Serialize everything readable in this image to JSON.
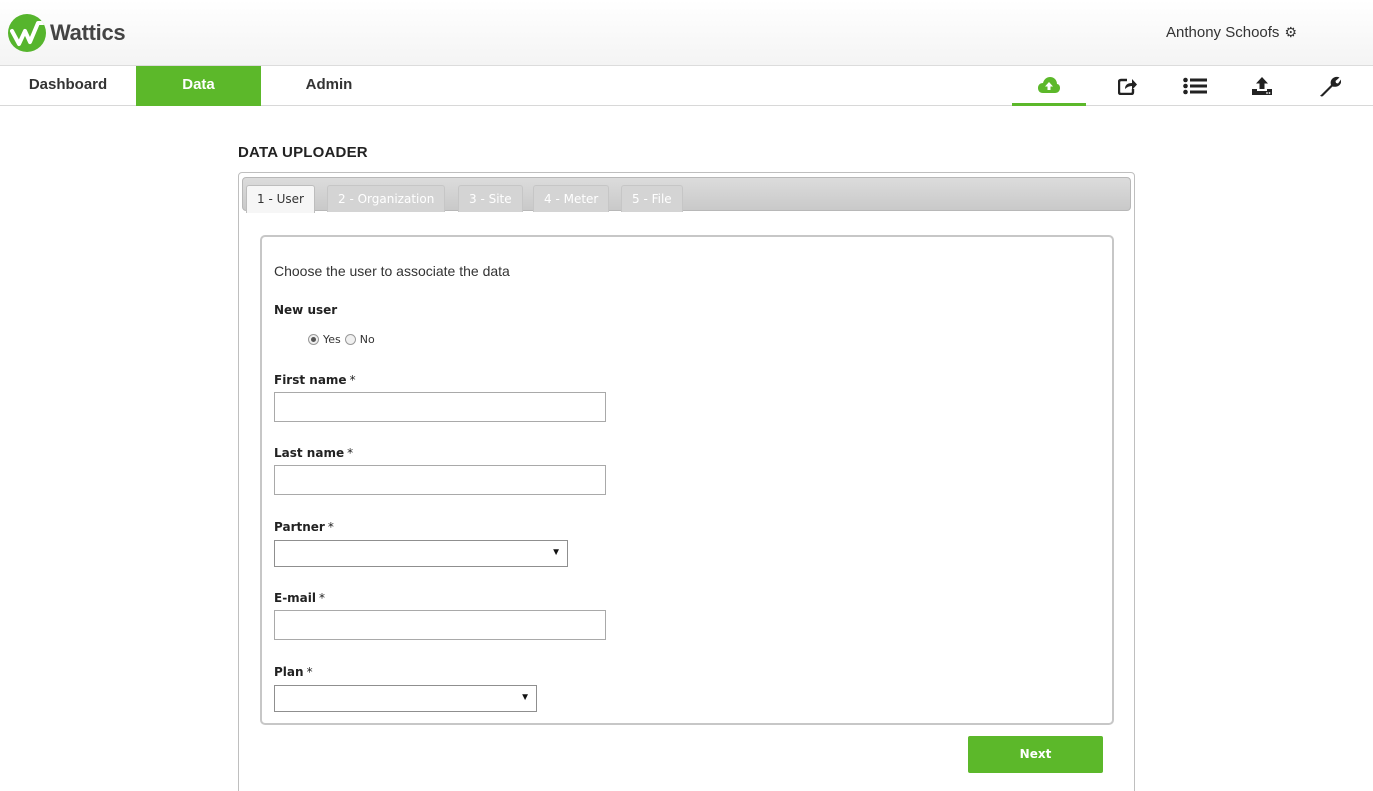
{
  "header": {
    "brand": "Wattics",
    "user_name": "Anthony Schoofs"
  },
  "nav": {
    "tabs": [
      {
        "label": "Dashboard",
        "active": false
      },
      {
        "label": "Data",
        "active": true
      },
      {
        "label": "Admin",
        "active": false
      }
    ],
    "tools": [
      "cloud-upload-icon",
      "share-icon",
      "list-icon",
      "upload-icon",
      "wrench-icon"
    ]
  },
  "page": {
    "title": "DATA UPLOADER"
  },
  "wizard": {
    "tabs": [
      "1 - User",
      "2 - Organization",
      "3 - Site",
      "4 - Meter",
      "5 - File"
    ],
    "active_tab": 0
  },
  "form": {
    "intro": "Choose the user to associate the data",
    "new_user_label": "New user",
    "radio_yes": "Yes",
    "radio_no": "No",
    "radio_selected": "Yes",
    "first_name_label": "First name",
    "last_name_label": "Last name",
    "partner_label": "Partner",
    "email_label": "E-mail",
    "plan_label": "Plan",
    "required_mark": "*",
    "first_name_value": "",
    "last_name_value": "",
    "email_value": "",
    "partner_value": "",
    "plan_value": ""
  },
  "actions": {
    "next_label": "Next"
  },
  "colors": {
    "accent": "#5cb82a"
  }
}
